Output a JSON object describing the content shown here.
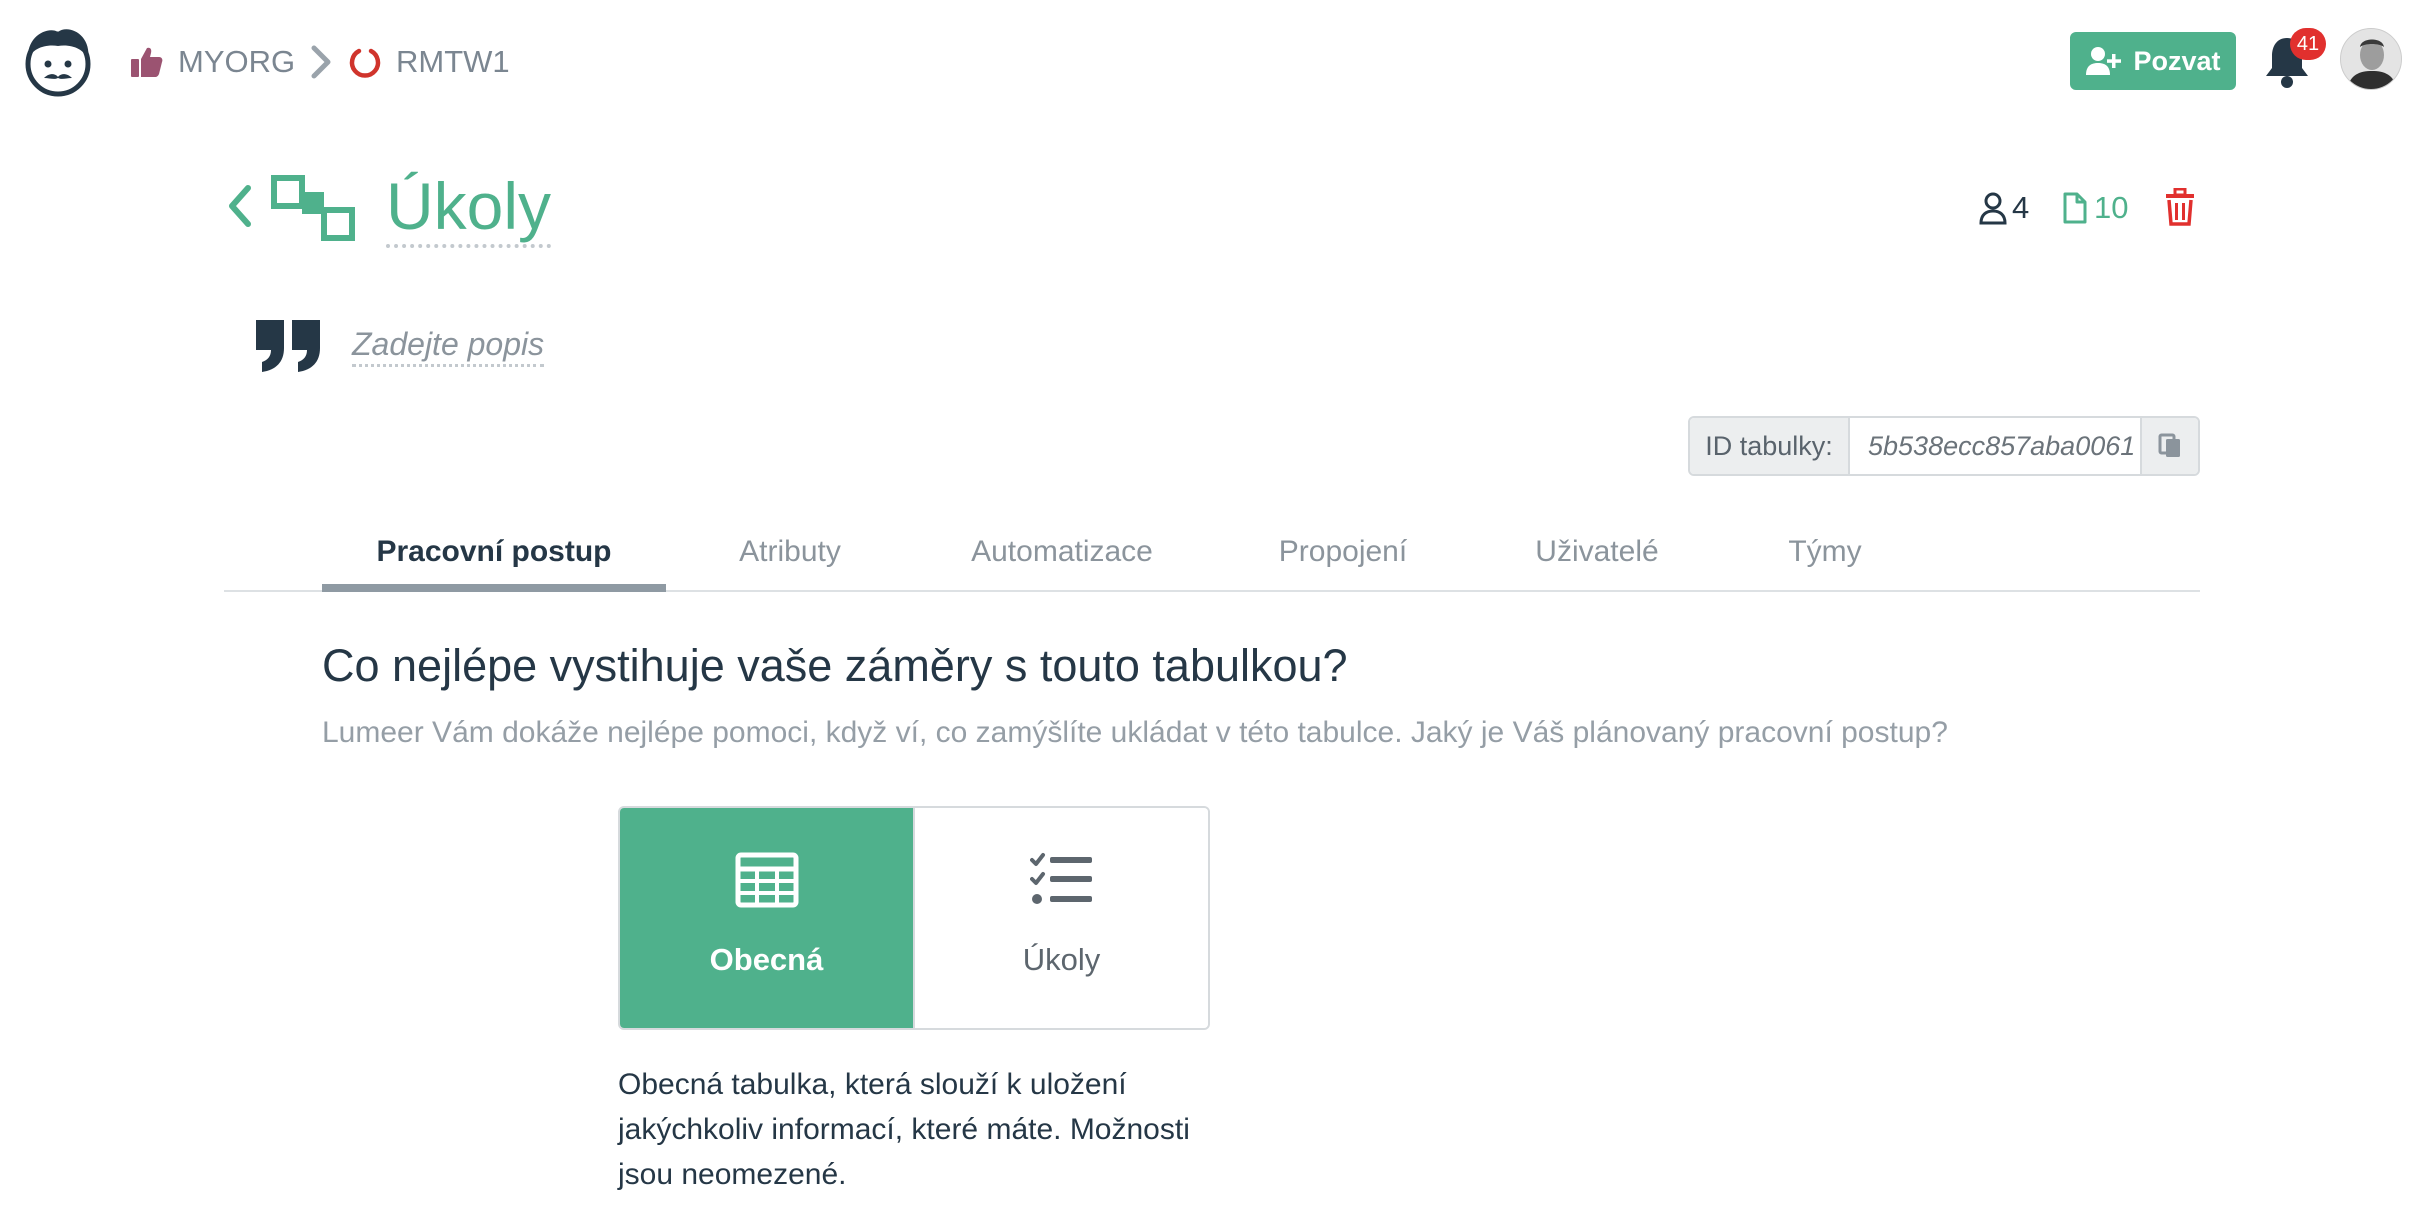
{
  "breadcrumb": {
    "organization": "MYORG",
    "project": "RMTW1"
  },
  "header": {
    "invite_label": "Pozvat",
    "notification_count": "41",
    "title": "Úkoly",
    "users_count": "4",
    "documents_count": "10",
    "description_placeholder": "Zadejte popis",
    "table_id_label": "ID tabulky:",
    "table_id": "5b538ecc857aba0061"
  },
  "tabs": [
    {
      "label": "Pracovní postup",
      "active": true
    },
    {
      "label": "Atributy",
      "active": false
    },
    {
      "label": "Automatizace",
      "active": false
    },
    {
      "label": "Propojení",
      "active": false
    },
    {
      "label": "Uživatelé",
      "active": false
    },
    {
      "label": "Týmy",
      "active": false
    }
  ],
  "purpose": {
    "question": "Co nejlépe vystihuje vaše záměry s touto tabulkou?",
    "hint": "Lumeer Vám dokáže nejlépe pomoci, když ví, co zamýšlíte ukládat v této tabulce. Jaký je Váš plánovaný pracovní postup?",
    "options": [
      {
        "label": "Obecná",
        "icon": "table-icon",
        "selected": true
      },
      {
        "label": "Úkoly",
        "icon": "checklist-icon",
        "selected": false
      }
    ],
    "selected_description": "Obecná tabulka, která slouží k uložení jakýchkoliv informací, které máte. Možnosti jsou neomezené."
  },
  "colors": {
    "accent": "#4fb18c",
    "danger": "#e1302e",
    "text": "#253746",
    "muted": "#8b949c",
    "org_icon": "#9b5371",
    "project_icon": "#d0342c"
  }
}
